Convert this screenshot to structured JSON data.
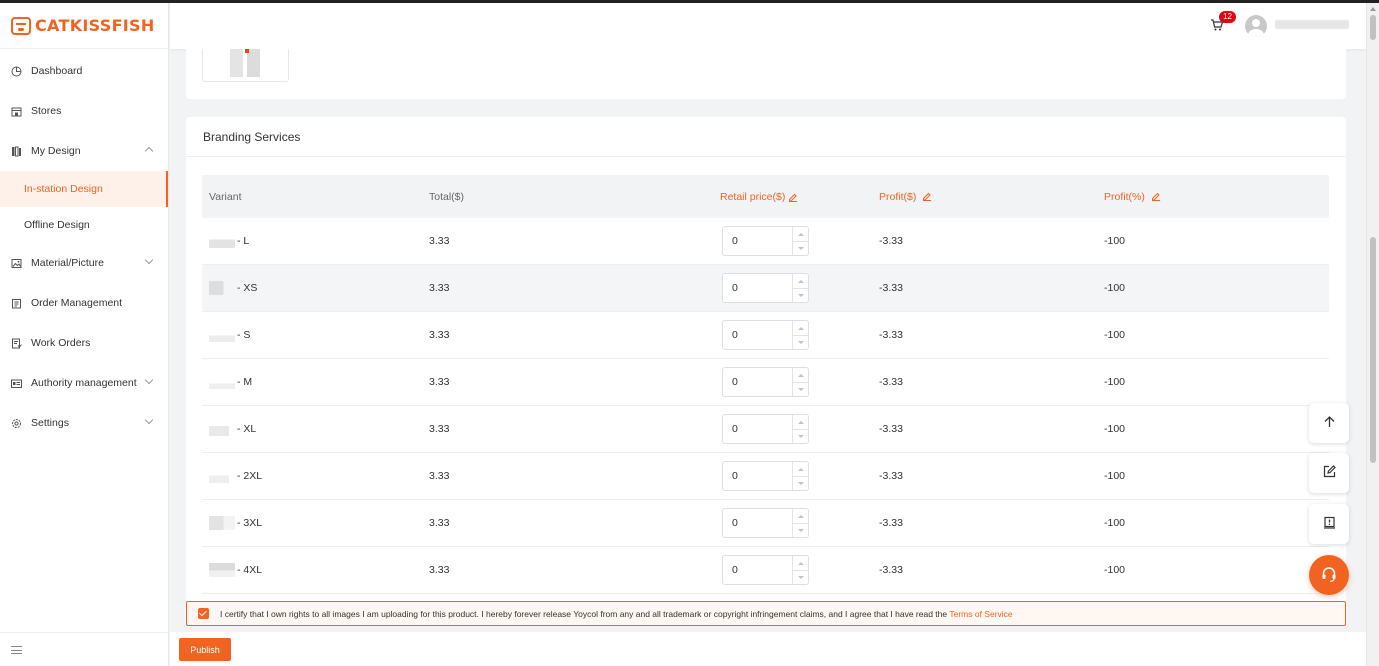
{
  "brand": {
    "name": "CATKISSFISH",
    "accent": "#f26322"
  },
  "header": {
    "cart_count": "12"
  },
  "sidebar": {
    "items": [
      {
        "label": "Dashboard",
        "icon": "pie-chart-icon"
      },
      {
        "label": "Stores",
        "icon": "store-icon"
      },
      {
        "label": "My Design",
        "icon": "books-icon",
        "expanded": true,
        "children": [
          {
            "label": "In-station Design",
            "active": true
          },
          {
            "label": "Offline Design"
          }
        ]
      },
      {
        "label": "Material/Picture",
        "icon": "image-icon"
      },
      {
        "label": "Order Management",
        "icon": "clipboard-icon"
      },
      {
        "label": "Work Orders",
        "icon": "work-order-icon"
      },
      {
        "label": "Authority management",
        "icon": "id-card-icon"
      },
      {
        "label": "Settings",
        "icon": "gear-icon"
      }
    ]
  },
  "branding": {
    "title": "Branding Services",
    "columns": {
      "variant": "Variant",
      "total": "Total($)",
      "retail": "Retail price($)",
      "profit_usd": "Profit($)",
      "profit_pct": "Profit(%)"
    },
    "rows": [
      {
        "variant": "- L",
        "total": "3.33",
        "retail": "0",
        "profit_usd": "-3.33",
        "profit_pct": "-100"
      },
      {
        "variant": "- XS",
        "total": "3.33",
        "retail": "0",
        "profit_usd": "-3.33",
        "profit_pct": "-100"
      },
      {
        "variant": "- S",
        "total": "3.33",
        "retail": "0",
        "profit_usd": "-3.33",
        "profit_pct": "-100"
      },
      {
        "variant": "- M",
        "total": "3.33",
        "retail": "0",
        "profit_usd": "-3.33",
        "profit_pct": "-100"
      },
      {
        "variant": "- XL",
        "total": "3.33",
        "retail": "0",
        "profit_usd": "-3.33",
        "profit_pct": "-100"
      },
      {
        "variant": "- 2XL",
        "total": "3.33",
        "retail": "0",
        "profit_usd": "-3.33",
        "profit_pct": "-100"
      },
      {
        "variant": "- 3XL",
        "total": "3.33",
        "retail": "0",
        "profit_usd": "-3.33",
        "profit_pct": "-100"
      },
      {
        "variant": "- 4XL",
        "total": "3.33",
        "retail": "0",
        "profit_usd": "-3.33",
        "profit_pct": "-100"
      }
    ]
  },
  "certify": {
    "checked": true,
    "text": "I certify that I own rights to all images I am uploading for this product. I hereby forever release Yoycol from any and all trademark or copyright infringement claims, and I agree that I have read the ",
    "link": "Terms of Service"
  },
  "footer": {
    "publish_label": "Publish"
  }
}
